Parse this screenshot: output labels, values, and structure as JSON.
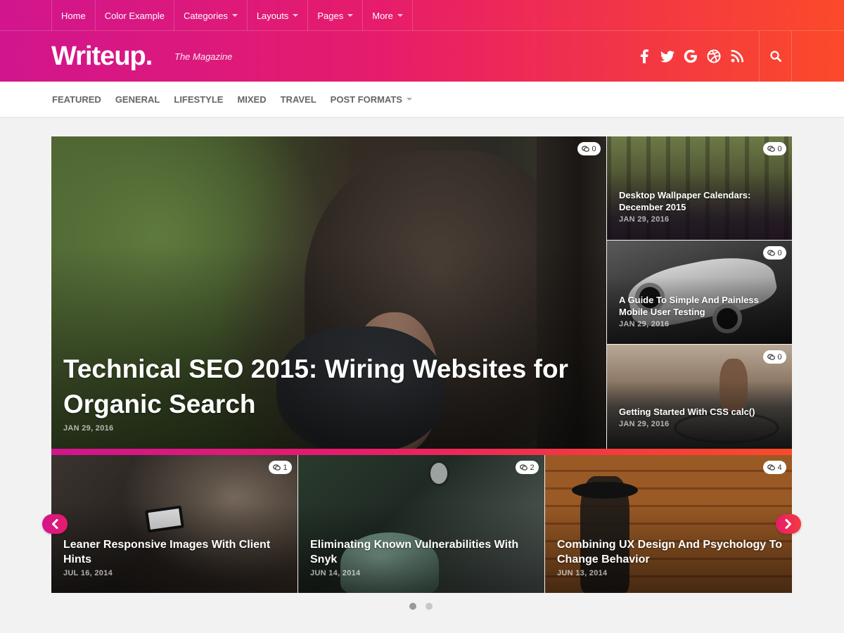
{
  "topnav": [
    {
      "label": "Home",
      "dropdown": false
    },
    {
      "label": "Color Example",
      "dropdown": false
    },
    {
      "label": "Categories",
      "dropdown": true
    },
    {
      "label": "Layouts",
      "dropdown": true
    },
    {
      "label": "Pages",
      "dropdown": true
    },
    {
      "label": "More",
      "dropdown": true
    }
  ],
  "brand": {
    "logo": "Writeup.",
    "tagline": "The Magazine"
  },
  "social_icons": [
    "facebook-icon",
    "twitter-icon",
    "google-icon",
    "dribbble-icon",
    "rss-icon"
  ],
  "search_icon": "search-icon",
  "categories": [
    {
      "label": "FEATURED",
      "dropdown": false
    },
    {
      "label": "GENERAL",
      "dropdown": false
    },
    {
      "label": "LIFESTYLE",
      "dropdown": false
    },
    {
      "label": "MIXED",
      "dropdown": false
    },
    {
      "label": "TRAVEL",
      "dropdown": false
    },
    {
      "label": "POST FORMATS",
      "dropdown": true
    }
  ],
  "featured": {
    "main": {
      "title": "Technical SEO 2015: Wiring Websites for Organic Search",
      "date": "JAN 29, 2016",
      "comments": "0"
    },
    "side": [
      {
        "title": "Desktop Wallpaper Calendars: December 2015",
        "date": "JAN 29, 2016",
        "comments": "0"
      },
      {
        "title": "A Guide To Simple And Painless Mobile User Testing",
        "date": "JAN 29, 2016",
        "comments": "0"
      },
      {
        "title": "Getting Started With CSS calc()",
        "date": "JAN 29, 2016",
        "comments": "0"
      }
    ]
  },
  "slider": {
    "slides": [
      {
        "title": "Leaner Responsive Images With Client Hints",
        "date": "JUL 16, 2014",
        "comments": "1"
      },
      {
        "title": "Eliminating Known Vulnerabilities With Snyk",
        "date": "JUN 14, 2014",
        "comments": "2"
      },
      {
        "title": "Combining UX Design And Psychology To Change Behavior",
        "date": "JUN 13, 2014",
        "comments": "4"
      }
    ],
    "pages": 2,
    "active_page": 1
  },
  "colors": {
    "gradient_start": "#d1158e",
    "gradient_mid": "#e61c6b",
    "gradient_end": "#fb4a2a"
  }
}
